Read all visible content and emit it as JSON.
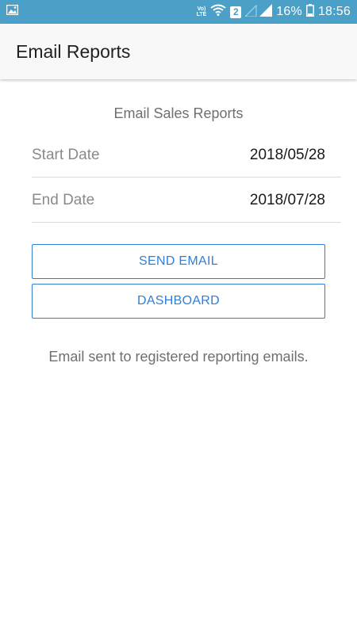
{
  "status_bar": {
    "volte_label": "Vo)\nLTE",
    "sim_number": "2",
    "battery_percent": "16%",
    "time": "18:56",
    "icons": [
      "image-notification-icon",
      "wifi-icon",
      "signal-icon",
      "battery-icon"
    ]
  },
  "app_bar": {
    "title": "Email Reports"
  },
  "main": {
    "section_title": "Email Sales Reports",
    "start_date": {
      "label": "Start Date",
      "value": "2018/05/28"
    },
    "end_date": {
      "label": "End Date",
      "value": "2018/07/28"
    },
    "send_email_label": "SEND EMAIL",
    "dashboard_label": "DASHBOARD",
    "message": "Email sent to registered reporting emails."
  },
  "colors": {
    "status_bar_bg": "#4aa0c6",
    "accent": "#2f7fd8"
  }
}
